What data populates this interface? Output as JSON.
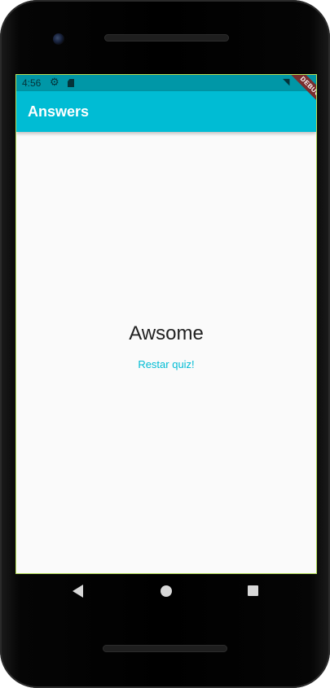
{
  "status_bar": {
    "time": "4:56",
    "icons": [
      "gear-icon",
      "sd-card-icon",
      "wifi-icon",
      "battery-icon"
    ]
  },
  "app_bar": {
    "title": "Answers",
    "color": "#00bcd4"
  },
  "debug_banner": {
    "label": "DEBUG"
  },
  "result": {
    "text": "Awsome",
    "restart_label": "Restar quiz!"
  },
  "nav_bar": {
    "icons": [
      "back-icon",
      "home-icon",
      "recents-icon"
    ]
  },
  "colors": {
    "accent": "#00bcd4",
    "status_bar": "#0097a7",
    "background": "#fafafa"
  }
}
